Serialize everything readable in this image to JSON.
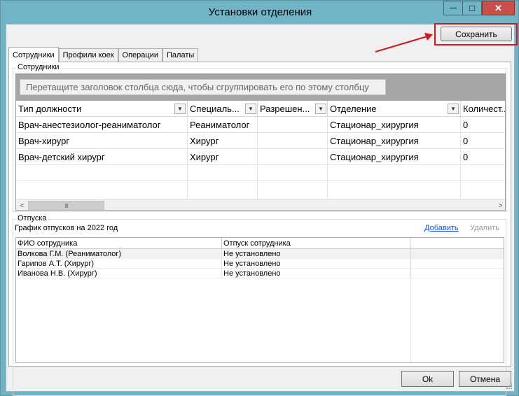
{
  "window": {
    "title": "Установки отделения",
    "minimize_glyph": "—",
    "maximize_glyph": "□",
    "close_glyph": "✕"
  },
  "toolbar": {
    "save_label": "Сохранить"
  },
  "tabs": [
    {
      "label": "Сотрудники",
      "active": true
    },
    {
      "label": "Профили коек",
      "active": false
    },
    {
      "label": "Операции",
      "active": false
    },
    {
      "label": "Палаты",
      "active": false
    }
  ],
  "employees": {
    "group_label": "Сотрудники",
    "group_panel_hint": "Перетащите заголовок столбца сюда, чтобы сгруппировать его по этому столбцу",
    "columns": [
      "Тип должности",
      "Специаль...",
      "Разрешен...",
      "Отделение",
      "Количест..."
    ],
    "rows": [
      [
        "Врач-анестезиолог-реаниматолог",
        "Реаниматолог",
        "",
        "Стационар_хирургия",
        "0"
      ],
      [
        "Врач-хирург",
        "Хирург",
        "",
        "Стационар_хирургия",
        "0"
      ],
      [
        "Врач-детский хирург",
        "Хирург",
        "",
        "Стационар_хирургия",
        "0"
      ]
    ],
    "scroll_left": "<",
    "scroll_right": ">",
    "thumb_grip": "III"
  },
  "vacations": {
    "group_label": "Отпуска",
    "title": "График отпусков на 2022 год",
    "add_label": "Добавить",
    "delete_label": "Удалить",
    "columns": [
      "ФИО сотрудника",
      "Отпуск сотрудника"
    ],
    "rows": [
      [
        "Волкова Г.М. (Реаниматолог)",
        "Не установлено"
      ],
      [
        "Гарипов А.Т. (Хирург)",
        "Не установлено"
      ],
      [
        "Иванова Н.В. (Хирург)",
        "Не установлено"
      ]
    ]
  },
  "footer": {
    "ok_label": "Ok",
    "cancel_label": "Отмена"
  },
  "colors": {
    "frame": "#70b4c6",
    "close": "#c7504a",
    "highlight": "#d0181f",
    "link": "#1a4fd0"
  }
}
